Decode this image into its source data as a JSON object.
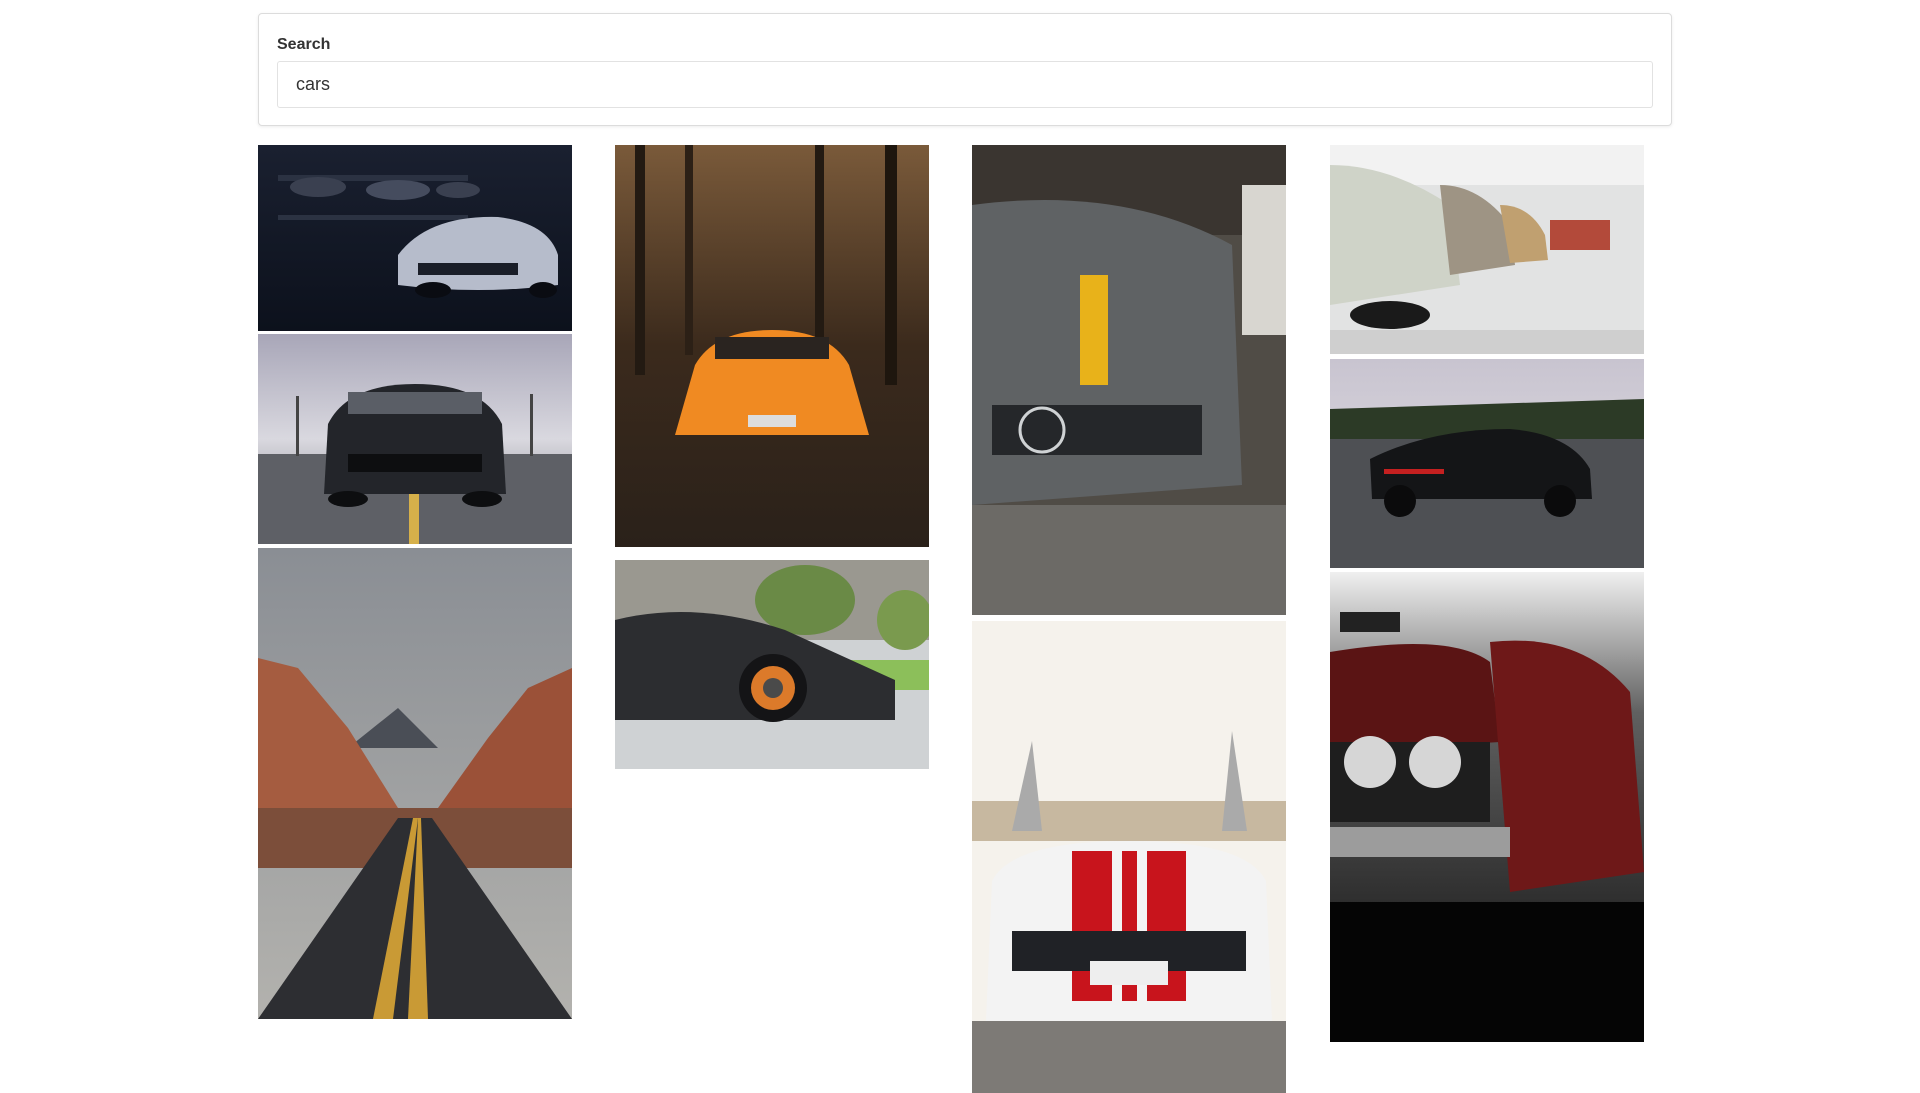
{
  "search": {
    "label": "Search",
    "value": "cars"
  },
  "gallery": {
    "images": [
      {
        "name": "chevrolet-camaro-garage",
        "icon": "car-photo"
      },
      {
        "name": "ford-mustang-road",
        "icon": "car-photo"
      },
      {
        "name": "desert-road",
        "icon": "landscape-photo"
      },
      {
        "name": "orange-lamborghini-forest",
        "icon": "car-photo"
      },
      {
        "name": "black-lamborghini-side",
        "icon": "car-photo"
      },
      {
        "name": "mercedes-amg-yellow-stripe",
        "icon": "car-photo"
      },
      {
        "name": "white-mustang-red-stripes",
        "icon": "car-photo"
      },
      {
        "name": "vintage-bmw-row",
        "icon": "car-photo"
      },
      {
        "name": "black-porsche-panamera",
        "icon": "car-photo"
      },
      {
        "name": "classic-red-car-headlights",
        "icon": "car-photo"
      }
    ]
  }
}
